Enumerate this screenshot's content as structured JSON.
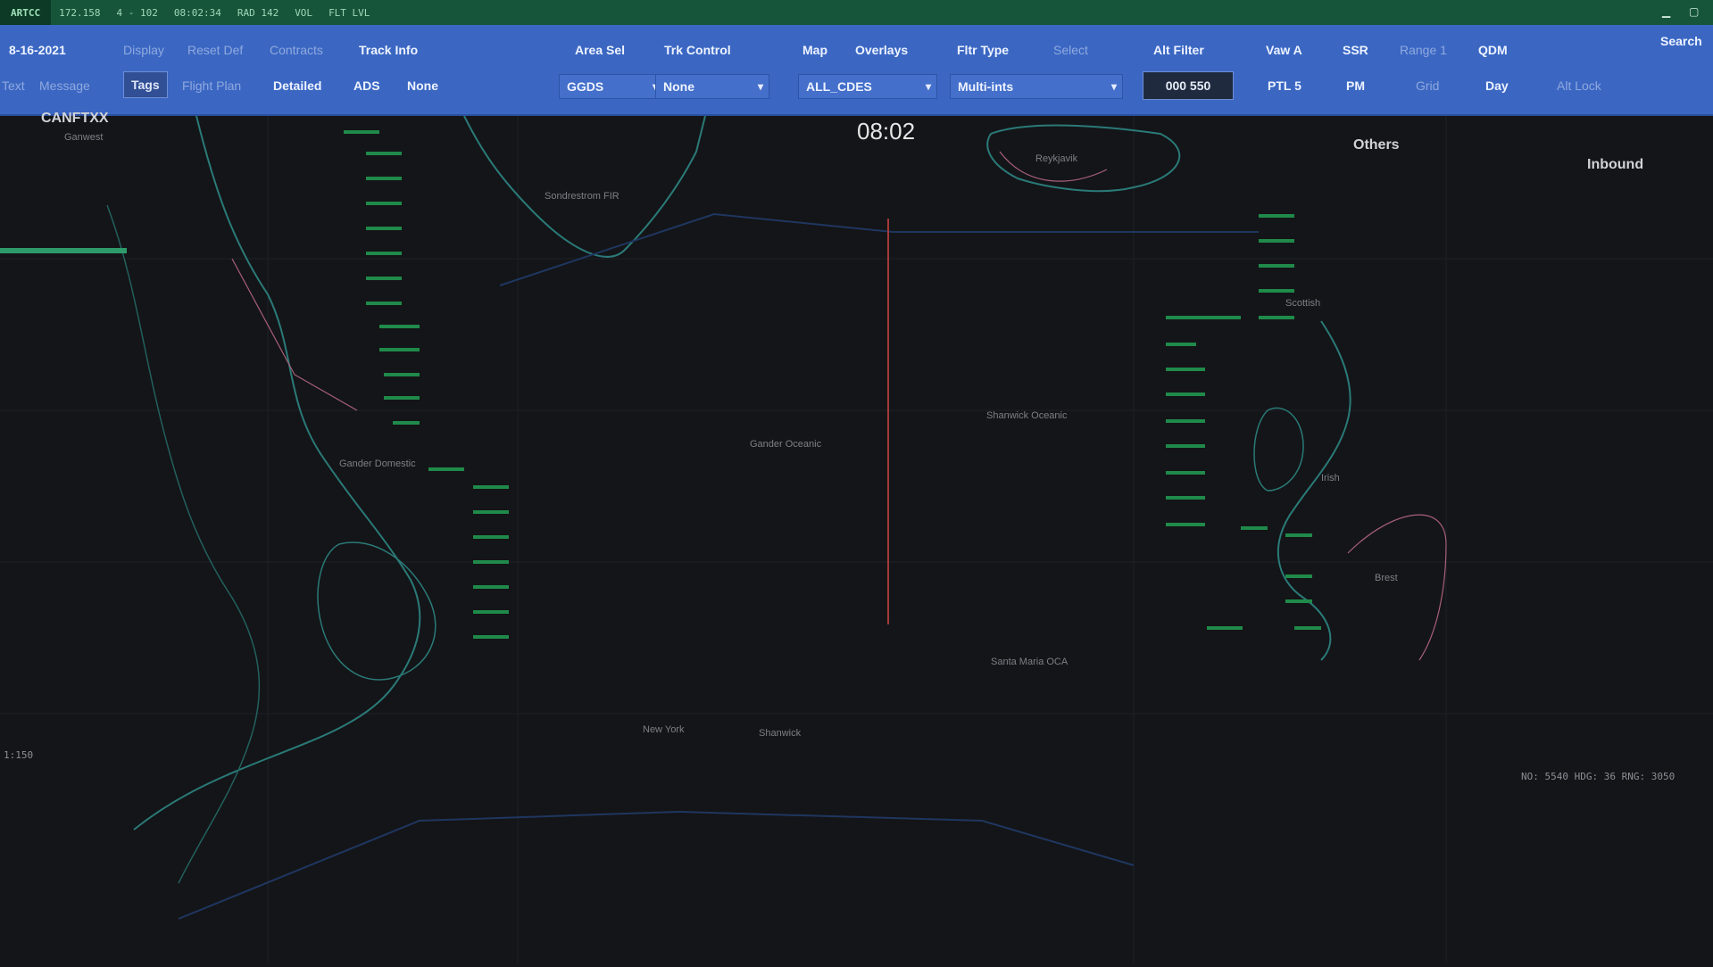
{
  "topbar": {
    "system_label": "ARTCC",
    "segments": [
      "172.158",
      "4 - 102",
      "08:02:34",
      "RAD 142",
      "VOL",
      "FLT LVL"
    ],
    "window_controls": [
      "▁",
      "▢"
    ]
  },
  "toolbar": {
    "row1": {
      "date": "8-16-2021",
      "display": "Display",
      "reset_def": "Reset Def",
      "contracts": "Contracts",
      "track_info": "Track Info",
      "area_sel": "Area Sel",
      "trk_control": "Trk Control",
      "map": "Map",
      "overlays": "Overlays",
      "fltr_type": "Fltr Type",
      "select": "Select",
      "alt_filter": "Alt Filter",
      "vaw_a": "Vaw A",
      "ssr": "SSR",
      "range_1": "Range 1",
      "qdm": "QDM",
      "search": "Search"
    },
    "row2": {
      "text": "Text",
      "message": "Message",
      "tags": "Tags",
      "flight_plan": "Flight Plan",
      "detailed": "Detailed",
      "ads": "ADS",
      "none": "None",
      "area_select_value": "GGDS",
      "trk_select_value": "None",
      "map_select_value": "ALL_CDES",
      "fltr_select_value": "Multi-ints",
      "alt_filter_value": "000 550",
      "ptl": "PTL 5",
      "pm": "PM",
      "grid": "Grid",
      "day": "Day",
      "alt_lock": "Alt Lock"
    }
  },
  "map": {
    "clock": "08:02",
    "left_header": "CANFTXX",
    "left_header_sub": "Ganwest",
    "others_header": "Others",
    "inbound_header": "Inbound",
    "region_labels": [
      "Gander Oceanic",
      "Shanwick Oceanic",
      "Sondrestrom FIR",
      "Reykjavik",
      "Santa Maria OCA",
      "New York",
      "Shanwick",
      "Gander Domestic",
      "Brest",
      "Scottish",
      "Irish"
    ],
    "bottom_left": "1:150",
    "status_bottom_right": "NO: 5540 HDG: 36 RNG: 3050"
  },
  "colors": {
    "map_bg": "#141518",
    "coast": "#2a7a78",
    "boundary_red": "#a33a3a",
    "boundary_pink": "#a8607a",
    "fix_green": "#1f8a4a",
    "toolbar_blue": "#3b67c3",
    "statusbar_green": "#16553a"
  }
}
